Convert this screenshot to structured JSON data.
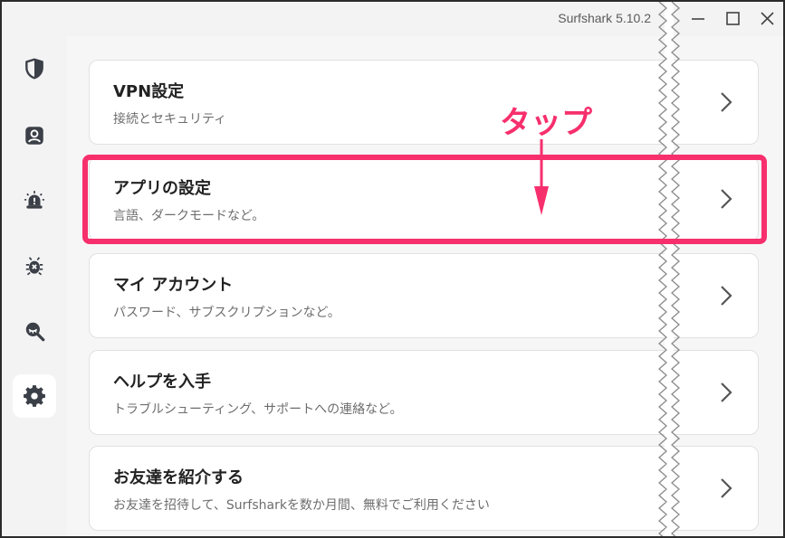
{
  "app": {
    "title": "Surfshark 5.10.2"
  },
  "window_controls": {
    "minimize": "minimize-icon",
    "maximize": "maximize-icon",
    "close": "close-icon"
  },
  "sidebar": {
    "items": [
      {
        "icon": "shield-icon"
      },
      {
        "icon": "user-icon"
      },
      {
        "icon": "alert-icon"
      },
      {
        "icon": "bug-icon"
      },
      {
        "icon": "search-eye-icon"
      },
      {
        "icon": "gear-icon",
        "active": true
      }
    ]
  },
  "settings": {
    "cards": [
      {
        "title": "VPN設定",
        "subtitle": "接続とセキュリティ"
      },
      {
        "title": "アプリの設定",
        "subtitle": "言語、ダークモードなど。"
      },
      {
        "title": "マイ アカウント",
        "subtitle": "パスワード、サブスクリプションなど。"
      },
      {
        "title": "ヘルプを入手",
        "subtitle": "トラブルシューティング、サポートへの連絡など。"
      },
      {
        "title": "お友達を紹介する",
        "subtitle": "お友達を招待して、Surfsharkを数か月間、無料でご利用ください"
      }
    ]
  },
  "annotation": {
    "label": "タップ",
    "color": "#f72f6d"
  },
  "colors": {
    "accent": "#f72f6d",
    "background": "#f6f6f7",
    "card": "#ffffff"
  }
}
